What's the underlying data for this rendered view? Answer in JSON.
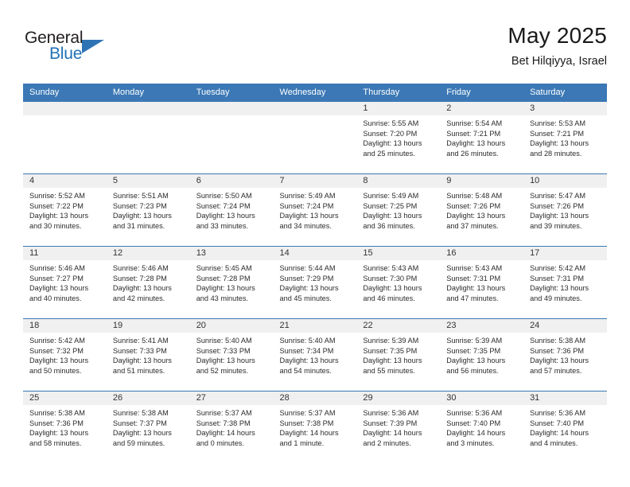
{
  "brand": {
    "line1": "General",
    "line2": "Blue",
    "triangle_color": "#2e74b5"
  },
  "header": {
    "title": "May 2025",
    "subtitle": "Bet Hilqiyya, Israel",
    "header_bg": "#3b78b5",
    "daynum_bg": "#f0f0f0"
  },
  "weekdays": [
    "Sunday",
    "Monday",
    "Tuesday",
    "Wednesday",
    "Thursday",
    "Friday",
    "Saturday"
  ],
  "weeks": [
    [
      {
        "day": ""
      },
      {
        "day": ""
      },
      {
        "day": ""
      },
      {
        "day": ""
      },
      {
        "day": "1",
        "sunrise": "Sunrise: 5:55 AM",
        "sunset": "Sunset: 7:20 PM",
        "daylight": "Daylight: 13 hours and 25 minutes."
      },
      {
        "day": "2",
        "sunrise": "Sunrise: 5:54 AM",
        "sunset": "Sunset: 7:21 PM",
        "daylight": "Daylight: 13 hours and 26 minutes."
      },
      {
        "day": "3",
        "sunrise": "Sunrise: 5:53 AM",
        "sunset": "Sunset: 7:21 PM",
        "daylight": "Daylight: 13 hours and 28 minutes."
      }
    ],
    [
      {
        "day": "4",
        "sunrise": "Sunrise: 5:52 AM",
        "sunset": "Sunset: 7:22 PM",
        "daylight": "Daylight: 13 hours and 30 minutes."
      },
      {
        "day": "5",
        "sunrise": "Sunrise: 5:51 AM",
        "sunset": "Sunset: 7:23 PM",
        "daylight": "Daylight: 13 hours and 31 minutes."
      },
      {
        "day": "6",
        "sunrise": "Sunrise: 5:50 AM",
        "sunset": "Sunset: 7:24 PM",
        "daylight": "Daylight: 13 hours and 33 minutes."
      },
      {
        "day": "7",
        "sunrise": "Sunrise: 5:49 AM",
        "sunset": "Sunset: 7:24 PM",
        "daylight": "Daylight: 13 hours and 34 minutes."
      },
      {
        "day": "8",
        "sunrise": "Sunrise: 5:49 AM",
        "sunset": "Sunset: 7:25 PM",
        "daylight": "Daylight: 13 hours and 36 minutes."
      },
      {
        "day": "9",
        "sunrise": "Sunrise: 5:48 AM",
        "sunset": "Sunset: 7:26 PM",
        "daylight": "Daylight: 13 hours and 37 minutes."
      },
      {
        "day": "10",
        "sunrise": "Sunrise: 5:47 AM",
        "sunset": "Sunset: 7:26 PM",
        "daylight": "Daylight: 13 hours and 39 minutes."
      }
    ],
    [
      {
        "day": "11",
        "sunrise": "Sunrise: 5:46 AM",
        "sunset": "Sunset: 7:27 PM",
        "daylight": "Daylight: 13 hours and 40 minutes."
      },
      {
        "day": "12",
        "sunrise": "Sunrise: 5:46 AM",
        "sunset": "Sunset: 7:28 PM",
        "daylight": "Daylight: 13 hours and 42 minutes."
      },
      {
        "day": "13",
        "sunrise": "Sunrise: 5:45 AM",
        "sunset": "Sunset: 7:28 PM",
        "daylight": "Daylight: 13 hours and 43 minutes."
      },
      {
        "day": "14",
        "sunrise": "Sunrise: 5:44 AM",
        "sunset": "Sunset: 7:29 PM",
        "daylight": "Daylight: 13 hours and 45 minutes."
      },
      {
        "day": "15",
        "sunrise": "Sunrise: 5:43 AM",
        "sunset": "Sunset: 7:30 PM",
        "daylight": "Daylight: 13 hours and 46 minutes."
      },
      {
        "day": "16",
        "sunrise": "Sunrise: 5:43 AM",
        "sunset": "Sunset: 7:31 PM",
        "daylight": "Daylight: 13 hours and 47 minutes."
      },
      {
        "day": "17",
        "sunrise": "Sunrise: 5:42 AM",
        "sunset": "Sunset: 7:31 PM",
        "daylight": "Daylight: 13 hours and 49 minutes."
      }
    ],
    [
      {
        "day": "18",
        "sunrise": "Sunrise: 5:42 AM",
        "sunset": "Sunset: 7:32 PM",
        "daylight": "Daylight: 13 hours and 50 minutes."
      },
      {
        "day": "19",
        "sunrise": "Sunrise: 5:41 AM",
        "sunset": "Sunset: 7:33 PM",
        "daylight": "Daylight: 13 hours and 51 minutes."
      },
      {
        "day": "20",
        "sunrise": "Sunrise: 5:40 AM",
        "sunset": "Sunset: 7:33 PM",
        "daylight": "Daylight: 13 hours and 52 minutes."
      },
      {
        "day": "21",
        "sunrise": "Sunrise: 5:40 AM",
        "sunset": "Sunset: 7:34 PM",
        "daylight": "Daylight: 13 hours and 54 minutes."
      },
      {
        "day": "22",
        "sunrise": "Sunrise: 5:39 AM",
        "sunset": "Sunset: 7:35 PM",
        "daylight": "Daylight: 13 hours and 55 minutes."
      },
      {
        "day": "23",
        "sunrise": "Sunrise: 5:39 AM",
        "sunset": "Sunset: 7:35 PM",
        "daylight": "Daylight: 13 hours and 56 minutes."
      },
      {
        "day": "24",
        "sunrise": "Sunrise: 5:38 AM",
        "sunset": "Sunset: 7:36 PM",
        "daylight": "Daylight: 13 hours and 57 minutes."
      }
    ],
    [
      {
        "day": "25",
        "sunrise": "Sunrise: 5:38 AM",
        "sunset": "Sunset: 7:36 PM",
        "daylight": "Daylight: 13 hours and 58 minutes."
      },
      {
        "day": "26",
        "sunrise": "Sunrise: 5:38 AM",
        "sunset": "Sunset: 7:37 PM",
        "daylight": "Daylight: 13 hours and 59 minutes."
      },
      {
        "day": "27",
        "sunrise": "Sunrise: 5:37 AM",
        "sunset": "Sunset: 7:38 PM",
        "daylight": "Daylight: 14 hours and 0 minutes."
      },
      {
        "day": "28",
        "sunrise": "Sunrise: 5:37 AM",
        "sunset": "Sunset: 7:38 PM",
        "daylight": "Daylight: 14 hours and 1 minute."
      },
      {
        "day": "29",
        "sunrise": "Sunrise: 5:36 AM",
        "sunset": "Sunset: 7:39 PM",
        "daylight": "Daylight: 14 hours and 2 minutes."
      },
      {
        "day": "30",
        "sunrise": "Sunrise: 5:36 AM",
        "sunset": "Sunset: 7:40 PM",
        "daylight": "Daylight: 14 hours and 3 minutes."
      },
      {
        "day": "31",
        "sunrise": "Sunrise: 5:36 AM",
        "sunset": "Sunset: 7:40 PM",
        "daylight": "Daylight: 14 hours and 4 minutes."
      }
    ]
  ]
}
